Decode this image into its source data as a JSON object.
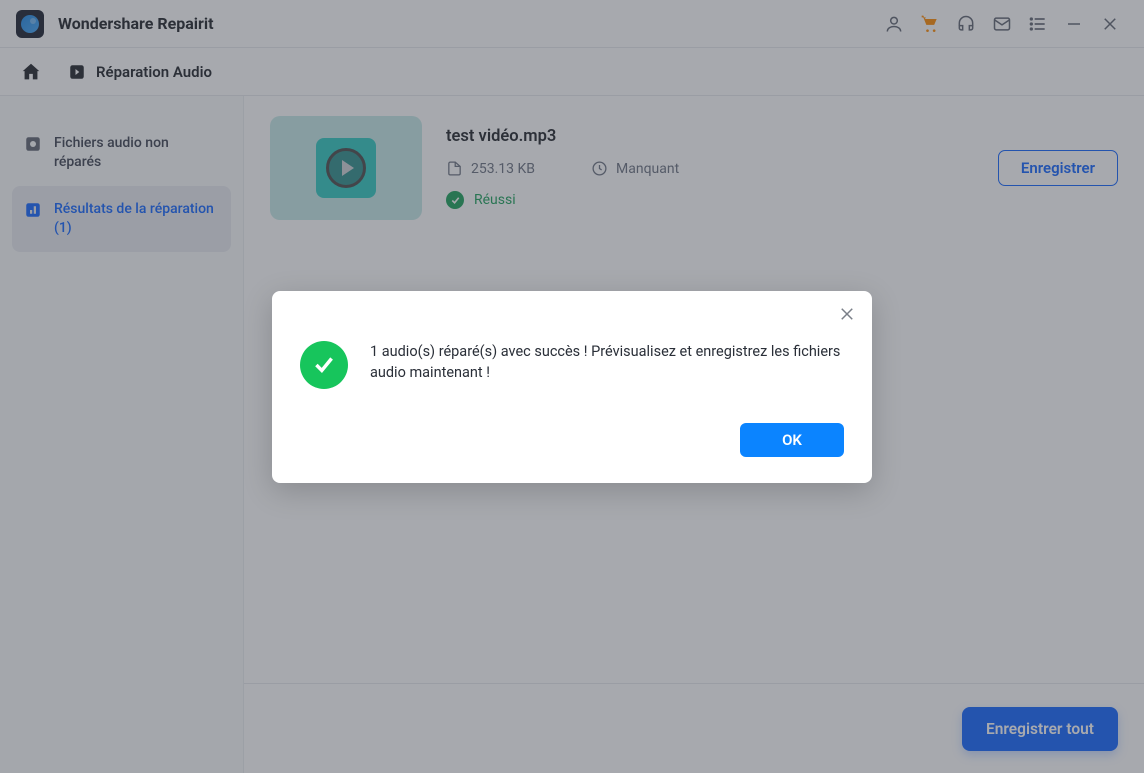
{
  "app": {
    "title": "Wondershare Repairit"
  },
  "nav": {
    "section": "Réparation Audio"
  },
  "sidebar": {
    "items": [
      {
        "label": "Fichiers audio non réparés"
      },
      {
        "label": "Résultats de la réparation (1)"
      }
    ]
  },
  "file": {
    "name": "test vidéo.mp3",
    "size": "253.13  KB",
    "duration": "Manquant",
    "status": "Réussi",
    "save_label": "Enregistrer"
  },
  "footer": {
    "save_all_label": "Enregistrer tout"
  },
  "dialog": {
    "message": "1 audio(s) réparé(s) avec succès ! Prévisualisez et enregistrez les fichiers audio maintenant !",
    "ok_label": "OK"
  }
}
